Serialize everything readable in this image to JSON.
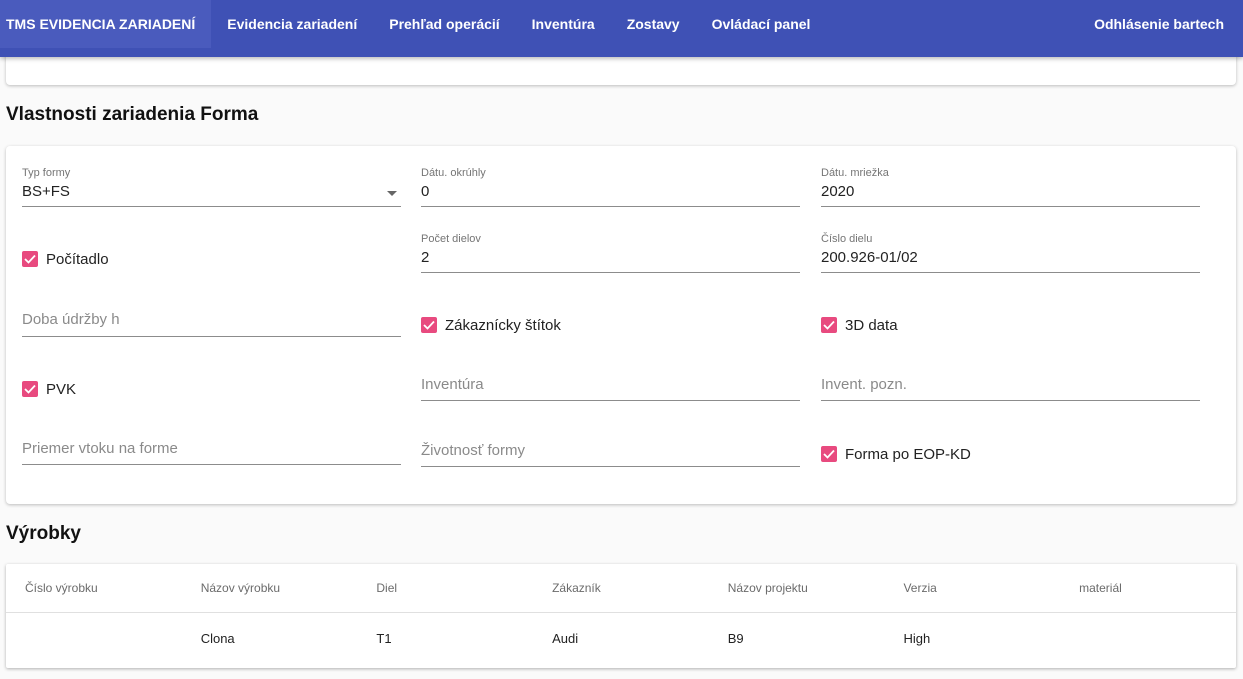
{
  "nav": {
    "brand": "TMS EVIDENCIA ZARIADENÍ",
    "items": [
      "Evidencia zariadení",
      "Prehľad operácií",
      "Inventúra",
      "Zostavy",
      "Ovládací panel"
    ],
    "logout": "Odhlásenie bartech",
    "color": "#3f51b5"
  },
  "props": {
    "title": "Vlastnosti zariadenia Forma",
    "typ_formy": {
      "label": "Typ formy",
      "value": "BS+FS"
    },
    "datu_okruhly": {
      "label": "Dátu. okrúhly",
      "value": "0"
    },
    "datu_mriezka": {
      "label": "Dátu. mriežka",
      "value": "2020"
    },
    "pocitadlo": {
      "label": "Počítadlo",
      "checked": true
    },
    "pocet_dielov": {
      "label": "Počet dielov",
      "value": "2"
    },
    "cislo_dielu": {
      "label": "Číslo dielu",
      "value": "200.926-01/02"
    },
    "doba_udrzby": {
      "placeholder": "Doba údržby h"
    },
    "zakaznicky_stitok": {
      "label": "Zákaznícky štítok",
      "checked": true
    },
    "data_3d": {
      "label": "3D data",
      "checked": true
    },
    "pvk": {
      "label": "PVK",
      "checked": true
    },
    "inventura": {
      "placeholder": "Inventúra"
    },
    "invent_pozn": {
      "placeholder": "Invent. pozn."
    },
    "priemer_vtoku": {
      "placeholder": "Priemer vtoku na forme"
    },
    "zivotnost": {
      "placeholder": "Životnosť formy"
    },
    "forma_eop": {
      "label": "Forma po EOP-KD",
      "checked": true
    },
    "check_color": "#e84a7f"
  },
  "products": {
    "title": "Výrobky",
    "columns": [
      "Číslo výrobku",
      "Názov výrobku",
      "Diel",
      "Zákazník",
      "Názov projektu",
      "Verzia",
      "materiál"
    ],
    "rows": [
      [
        "",
        "Clona",
        "T1",
        "Audi",
        "B9",
        "High",
        ""
      ]
    ]
  }
}
